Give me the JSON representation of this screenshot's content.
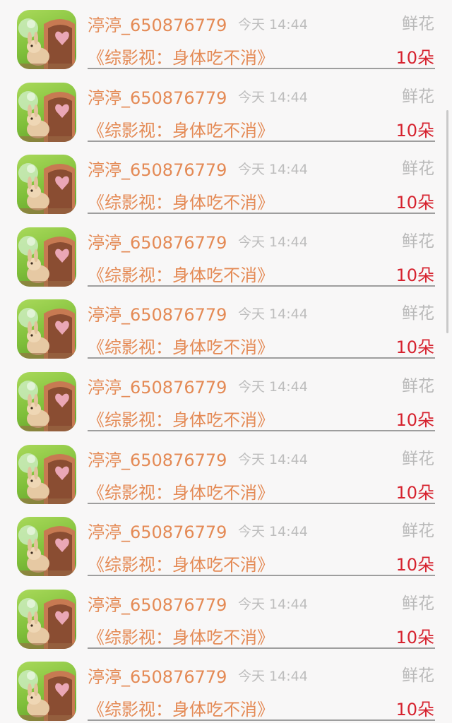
{
  "records": [
    {
      "username": "渟渟_650876779",
      "time": "今天 14:44",
      "gift_type": "鲜花",
      "title": "《综影视：身体吃不消》",
      "count": "10朵"
    },
    {
      "username": "渟渟_650876779",
      "time": "今天 14:44",
      "gift_type": "鲜花",
      "title": "《综影视：身体吃不消》",
      "count": "10朵"
    },
    {
      "username": "渟渟_650876779",
      "time": "今天 14:44",
      "gift_type": "鲜花",
      "title": "《综影视：身体吃不消》",
      "count": "10朵"
    },
    {
      "username": "渟渟_650876779",
      "time": "今天 14:44",
      "gift_type": "鲜花",
      "title": "《综影视：身体吃不消》",
      "count": "10朵"
    },
    {
      "username": "渟渟_650876779",
      "time": "今天 14:44",
      "gift_type": "鲜花",
      "title": "《综影视：身体吃不消》",
      "count": "10朵"
    },
    {
      "username": "渟渟_650876779",
      "time": "今天 14:44",
      "gift_type": "鲜花",
      "title": "《综影视：身体吃不消》",
      "count": "10朵"
    },
    {
      "username": "渟渟_650876779",
      "time": "今天 14:44",
      "gift_type": "鲜花",
      "title": "《综影视：身体吃不消》",
      "count": "10朵"
    },
    {
      "username": "渟渟_650876779",
      "time": "今天 14:44",
      "gift_type": "鲜花",
      "title": "《综影视：身体吃不消》",
      "count": "10朵"
    },
    {
      "username": "渟渟_650876779",
      "time": "今天 14:44",
      "gift_type": "鲜花",
      "title": "《综影视：身体吃不消》",
      "count": "10朵"
    },
    {
      "username": "渟渟_650876779",
      "time": "今天 14:44",
      "gift_type": "鲜花",
      "title": "《综影视：身体吃不消》",
      "count": "10朵"
    }
  ],
  "colors": {
    "username": "#e48a55",
    "count": "#d6232f",
    "muted": "#bdbdbd",
    "background": "#f8f7f7"
  },
  "avatar_icon": "rabbit-in-flowerpot-avatar"
}
